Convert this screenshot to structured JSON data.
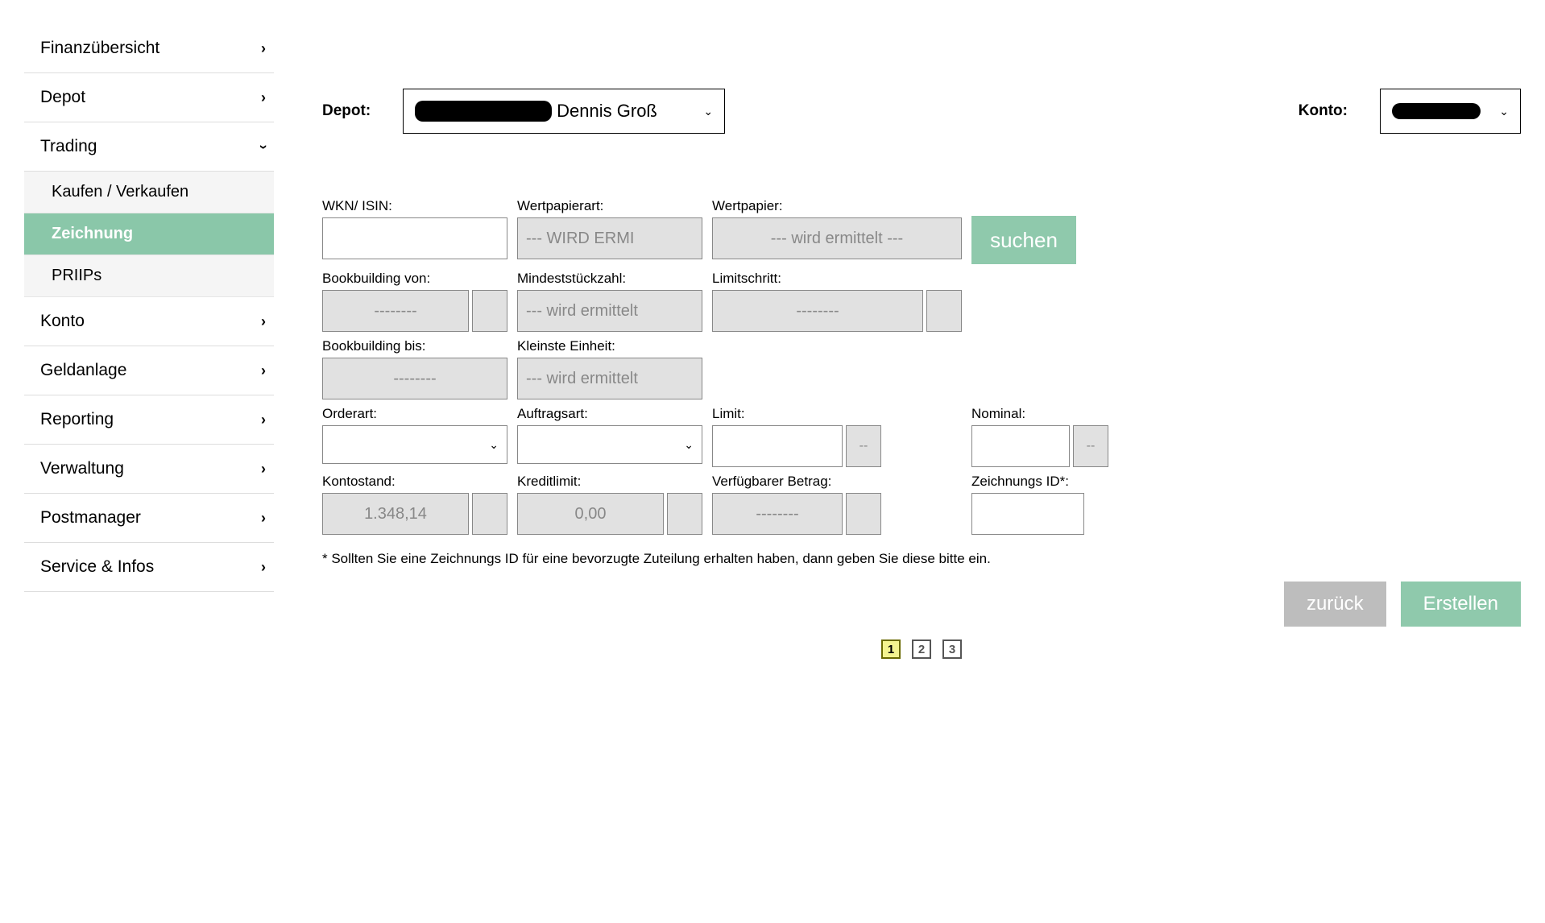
{
  "sidebar": {
    "items": [
      {
        "label": "Finanzübersicht",
        "expanded": false
      },
      {
        "label": "Depot",
        "expanded": false
      },
      {
        "label": "Trading",
        "expanded": true,
        "children": [
          {
            "label": "Kaufen / Verkaufen",
            "active": false
          },
          {
            "label": "Zeichnung",
            "active": true
          },
          {
            "label": "PRIIPs",
            "active": false
          }
        ]
      },
      {
        "label": "Konto",
        "expanded": false
      },
      {
        "label": "Geldanlage",
        "expanded": false
      },
      {
        "label": "Reporting",
        "expanded": false
      },
      {
        "label": "Verwaltung",
        "expanded": false
      },
      {
        "label": "Postmanager",
        "expanded": false
      },
      {
        "label": "Service & Infos",
        "expanded": false
      }
    ]
  },
  "top": {
    "depot_label": "Depot:",
    "konto_label": "Konto:",
    "depot_value_suffix": "Dennis Groß"
  },
  "fields": {
    "wkn_isin": {
      "label": "WKN/ ISIN:",
      "value": ""
    },
    "wertpapierart": {
      "label": "Wertpapierart:",
      "value": "--- WIRD ERMI"
    },
    "wertpapier": {
      "label": "Wertpapier:",
      "value": "--- wird ermittelt ---"
    },
    "bookbuilding_von": {
      "label": "Bookbuilding von:",
      "value": "--------"
    },
    "mindeststueckzahl": {
      "label": "Mindeststückzahl:",
      "value": "--- wird ermittelt"
    },
    "limitschritt": {
      "label": "Limitschritt:",
      "value": "--------"
    },
    "bookbuilding_bis": {
      "label": "Bookbuilding bis:",
      "value": "--------"
    },
    "kleinste_einheit": {
      "label": "Kleinste Einheit:",
      "value": "--- wird ermittelt"
    },
    "orderart": {
      "label": "Orderart:",
      "value": ""
    },
    "auftragsart": {
      "label": "Auftragsart:",
      "value": ""
    },
    "limit": {
      "label": "Limit:",
      "value": "",
      "unit": "--"
    },
    "nominal": {
      "label": "Nominal:",
      "value": "",
      "unit": "--"
    },
    "kontostand": {
      "label": "Kontostand:",
      "value": "1.348,14"
    },
    "kreditlimit": {
      "label": "Kreditlimit:",
      "value": "0,00"
    },
    "verfuegbarer_betrag": {
      "label": "Verfügbarer Betrag:",
      "value": "--------"
    },
    "zeichnungs_id": {
      "label": "Zeichnungs ID*:",
      "value": ""
    }
  },
  "buttons": {
    "suchen": "suchen",
    "zurueck": "zurück",
    "erstellen": "Erstellen"
  },
  "footnote": "* Sollten Sie eine Zeichnungs ID für eine bevorzugte Zuteilung erhalten haben, dann geben Sie diese bitte ein.",
  "pages": [
    "1",
    "2",
    "3"
  ],
  "active_page": 0
}
